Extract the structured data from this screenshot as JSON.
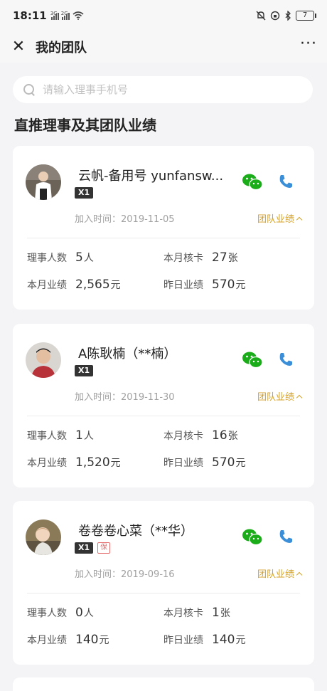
{
  "status_bar": {
    "time": "18:11",
    "signal1_label": "3G",
    "signal2_label": "2G",
    "battery": "7"
  },
  "nav": {
    "title": "我的团队",
    "close_icon": "close-icon",
    "more_icon": "more-icon"
  },
  "search": {
    "placeholder": "请输入理事手机号",
    "value": ""
  },
  "section_title": "直推理事及其团队业绩",
  "labels": {
    "join_prefix": "加入时间：",
    "team_perf": "团队业绩",
    "member_count": "理事人数",
    "monthly_cards": "本月核卡",
    "monthly_perf": "本月业绩",
    "yesterday_perf": "昨日业绩",
    "unit_person": "人",
    "unit_card": "张",
    "unit_yuan": "元"
  },
  "colors": {
    "accent_gold": "#d4a22a",
    "wechat_green": "#1aad19",
    "phone_blue": "#3b8ed8",
    "badge_dark": "#333333",
    "badge_red": "#e36b6b"
  },
  "members": [
    {
      "name": "云帆-备用号 yunfansw...",
      "badge": "X1",
      "extra_badge": "",
      "join_time": "2019-11-05",
      "member_count": "5",
      "monthly_cards": "27",
      "monthly_perf": "2,565",
      "yesterday_perf": "570"
    },
    {
      "name": "A陈耿楠（**楠）",
      "badge": "X1",
      "extra_badge": "",
      "join_time": "2019-11-30",
      "member_count": "1",
      "monthly_cards": "16",
      "monthly_perf": "1,520",
      "yesterday_perf": "570"
    },
    {
      "name": "卷卷卷心菜（**华）",
      "badge": "X1",
      "extra_badge": "保",
      "join_time": "2019-09-16",
      "member_count": "0",
      "monthly_cards": "1",
      "monthly_perf": "140",
      "yesterday_perf": "140"
    }
  ]
}
